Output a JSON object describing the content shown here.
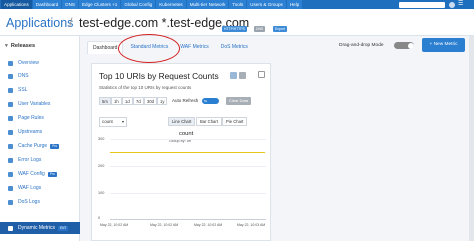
{
  "topnav": {
    "tabs": [
      "Applications",
      "Dashboard",
      "DNS",
      "Edge Clusters +1",
      "Global Config",
      "Kubernetes",
      "Multi-tier Network",
      "Tools",
      "Users & Groups",
      "Help"
    ]
  },
  "titlebar": {
    "breadcrumb": "Applications",
    "separator": "/",
    "app_name": "test-edge.com *.test-edge.com",
    "badges": [
      "HTTP/HTTPS",
      "DNS",
      "Export"
    ]
  },
  "sidebar": {
    "heading": "Releases",
    "items": [
      {
        "label": "Overview"
      },
      {
        "label": "DNS"
      },
      {
        "label": "SSL"
      },
      {
        "label": "User Variables"
      },
      {
        "label": "Page Rules"
      },
      {
        "label": "Upstreams"
      },
      {
        "label": "Cache Purge",
        "badge": "Pro"
      },
      {
        "label": "Error Logs"
      },
      {
        "label": "WAF Config",
        "badge": "Pro"
      },
      {
        "label": "WAF Logs"
      },
      {
        "label": "DoS Logs"
      },
      {
        "label": "Dynamic Metrics",
        "badge": "ENT",
        "active": true
      }
    ]
  },
  "content": {
    "tabs": [
      "Dashboard",
      "Standard Metrics",
      "WAF Metrics",
      "DoS Metrics"
    ],
    "active_tab": "Dashboard",
    "drag_drop_label": "Drag-and-drop Mode",
    "new_metric_label": "+ New Metric"
  },
  "panel": {
    "title": "Top 10 URIs by Request Counts",
    "subtitle": "Statistics of the top 10 URIs by request counts",
    "ranges": [
      "5m",
      "1h",
      "1d",
      "7d",
      "30d",
      "1y"
    ],
    "active_range": "5m",
    "auto_refresh_label": "Auto Refresh",
    "auto_refresh_state": "5s",
    "clear_data_label": "Clear Data",
    "count_select": "count",
    "chart_types": [
      "Line Chart",
      "Bar Chart",
      "Pie Chart"
    ],
    "active_chart_type": "Line Chart"
  },
  "chart_data": {
    "type": "line",
    "title": "count",
    "subtitle": "Group by: uri",
    "y_ticks": [
      300,
      200,
      100,
      0
    ],
    "x_ticks": [
      "May 22, 10:02 AM",
      "May 22, 10:02 AM",
      "May 22, 10:02 AM",
      "May 22, 10:03 AM"
    ],
    "series": [
      {
        "values": [
          252,
          252,
          252,
          252
        ],
        "color": "#e8c51e"
      }
    ],
    "ylim": [
      0,
      300
    ]
  }
}
